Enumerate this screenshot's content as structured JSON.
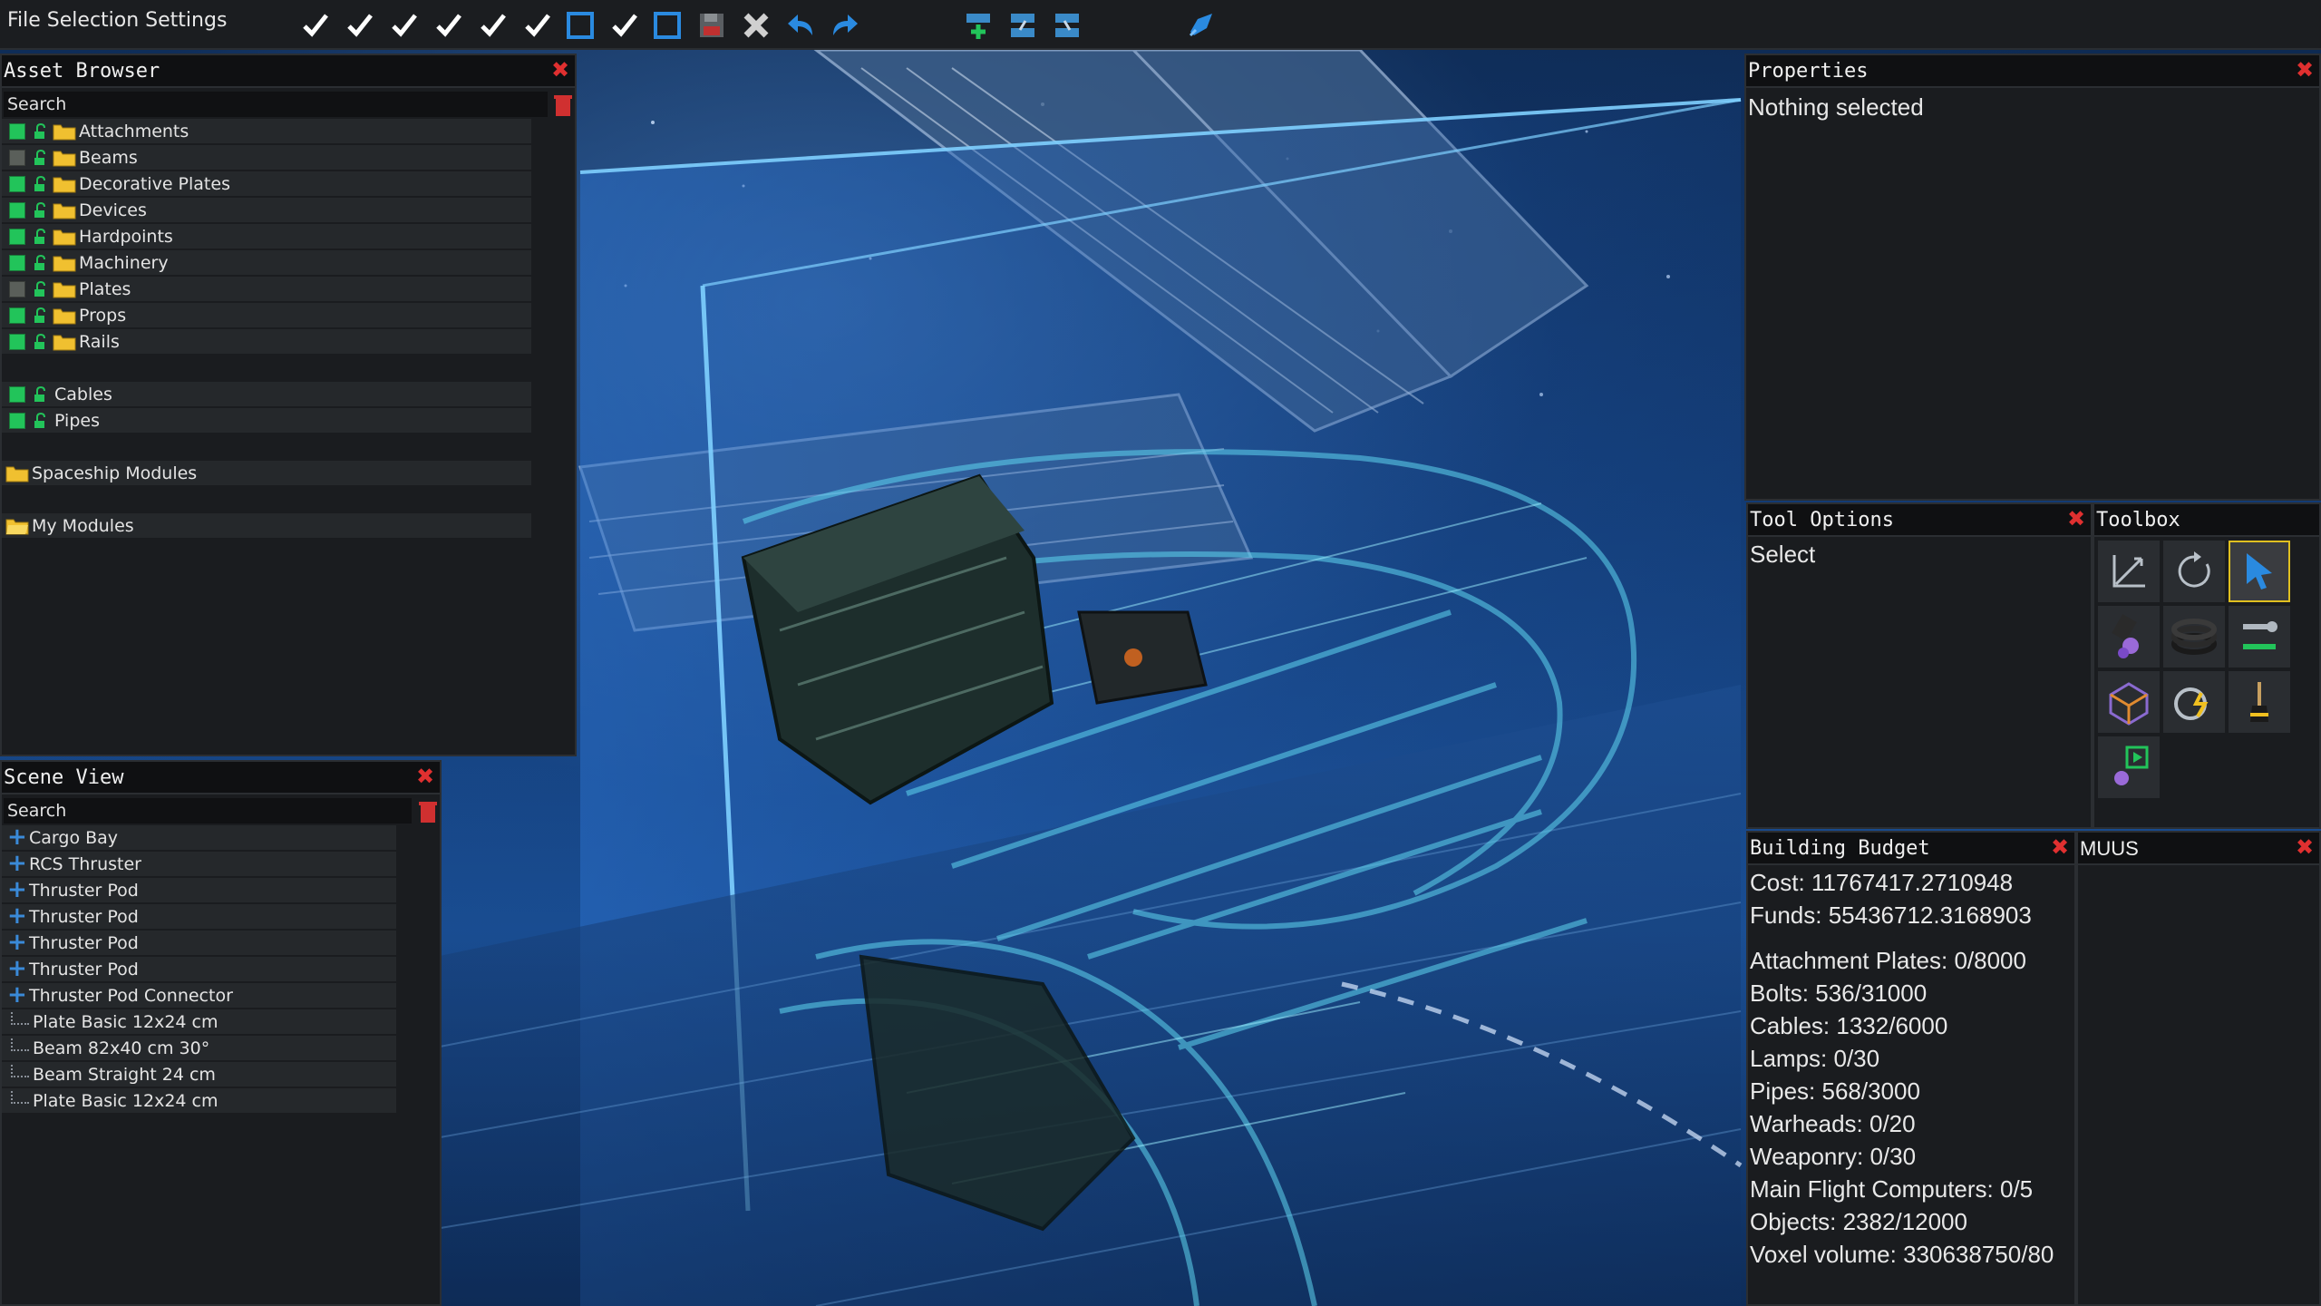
{
  "toolbar": {
    "menu_label": "File Selection Settings",
    "buttons": [
      "check",
      "check",
      "check",
      "check",
      "check",
      "check",
      "square",
      "check",
      "square",
      "save",
      "delete",
      "undo",
      "redo",
      "module-add",
      "module-link",
      "module-link",
      "launch"
    ]
  },
  "asset_browser": {
    "title": "Asset Browser",
    "search_placeholder": "Search",
    "items": [
      {
        "label": "Attachments",
        "checked": true
      },
      {
        "label": "Beams",
        "checked": false
      },
      {
        "label": "Decorative Plates",
        "checked": true
      },
      {
        "label": "Devices",
        "checked": true
      },
      {
        "label": "Hardpoints",
        "checked": true
      },
      {
        "label": "Machinery",
        "checked": true
      },
      {
        "label": "Plates",
        "checked": false
      },
      {
        "label": "Props",
        "checked": true
      },
      {
        "label": "Rails",
        "checked": true
      }
    ],
    "extra_items": [
      {
        "label": "Cables",
        "checked": true
      },
      {
        "label": "Pipes",
        "checked": true
      }
    ],
    "modules": [
      "Spaceship Modules",
      "My Modules"
    ]
  },
  "scene_view": {
    "title": "Scene View",
    "search_placeholder": "Search",
    "groups": [
      "Cargo Bay",
      "RCS Thruster",
      "Thruster Pod",
      "Thruster Pod",
      "Thruster Pod",
      "Thruster Pod",
      "Thruster Pod Connector"
    ],
    "children": [
      "Plate Basic 12x24 cm",
      "Beam 82x40 cm 30°",
      "Beam Straight 24 cm",
      "Plate Basic 12x24 cm"
    ]
  },
  "properties": {
    "title": "Properties",
    "message": "Nothing selected"
  },
  "tool_options": {
    "title": "Tool Options",
    "value": "Select"
  },
  "toolbox": {
    "title": "Toolbox",
    "tools": [
      "move-tool-icon",
      "rotate-tool-icon",
      "select-tool-icon",
      "paint-tool-icon",
      "cable-tool-icon",
      "wrench-tool-icon",
      "voxel-tool-icon",
      "power-tool-icon",
      "brush-tool-icon",
      "play-tool-icon"
    ],
    "selected": "select-tool-icon"
  },
  "budget": {
    "title": "Building Budget",
    "cost": "Cost: 11767417.2710948",
    "funds": "Funds: 55436712.3168903",
    "lines": [
      "Attachment Plates: 0/8000",
      "Bolts: 536/31000",
      "Cables: 1332/6000",
      "Lamps: 0/30",
      "Pipes: 568/3000",
      "Warheads: 0/20",
      "Weaponry: 0/30",
      "Main Flight Computers: 0/5",
      "Objects: 2382/12000",
      "Voxel volume: 330638750/80"
    ]
  },
  "muus": {
    "title": "MUUS"
  },
  "colors": {
    "accent": "#e0c020",
    "close": "#e03030",
    "check": "#22c45a"
  }
}
